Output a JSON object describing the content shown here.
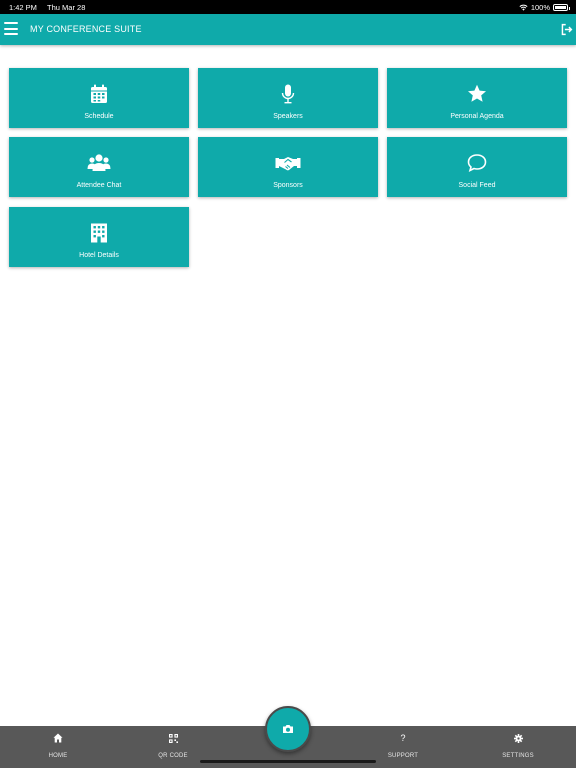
{
  "status_bar": {
    "time": "1:42 PM",
    "date": "Thu Mar 28",
    "battery": "100%"
  },
  "header": {
    "title": "MY CONFERENCE SUITE"
  },
  "tiles": [
    {
      "label": "Schedule",
      "icon": "calendar-icon"
    },
    {
      "label": "Speakers",
      "icon": "microphone-icon"
    },
    {
      "label": "Personal Agenda",
      "icon": "star-icon"
    },
    {
      "label": "Attendee Chat",
      "icon": "users-icon"
    },
    {
      "label": "Sponsors",
      "icon": "handshake-icon"
    },
    {
      "label": "Social Feed",
      "icon": "speech-bubble-icon"
    },
    {
      "label": "Hotel Details",
      "icon": "building-icon"
    }
  ],
  "bottom_nav": [
    {
      "label": "HOME",
      "icon": "home-icon"
    },
    {
      "label": "QR CODE",
      "icon": "qr-code-icon"
    },
    {
      "label": "SUPPORT",
      "icon": "question-icon",
      "glyph": "?"
    },
    {
      "label": "SETTINGS",
      "icon": "gear-icon"
    }
  ],
  "camera_button": {
    "icon": "camera-icon"
  },
  "colors": {
    "accent": "#0faaaa",
    "nav_bar": "#585858",
    "status_bar": "#000000",
    "background": "#ffffff"
  }
}
